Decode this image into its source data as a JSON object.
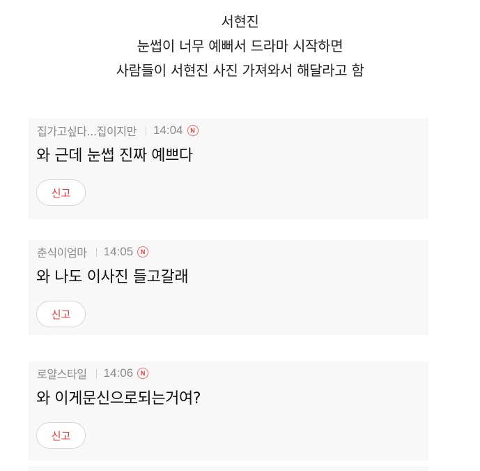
{
  "post": {
    "title_lines": [
      "서현진",
      "눈썹이 너무 예뻐서 드라마 시작하면",
      "사람들이 서현진 사진 가져와서 해달라고 함"
    ]
  },
  "comments": [
    {
      "author": "집가고싶다...집이지만",
      "time": "14:04",
      "badge": "N",
      "text": "와 근데 눈썹 진짜 예쁘다",
      "report_label": "신고"
    },
    {
      "author": "춘식이엄마",
      "time": "14:05",
      "badge": "N",
      "text": "와 나도 이사진 들고갈래",
      "report_label": "신고"
    },
    {
      "author": "로얄스타일",
      "time": "14:06",
      "badge": "N",
      "text": "와 이게문신으로되는거여?",
      "report_label": "신고"
    }
  ],
  "colors": {
    "accent_red": "#e53935",
    "meta_gray": "#8a8a8a",
    "card_background": "#f8f8f8"
  }
}
